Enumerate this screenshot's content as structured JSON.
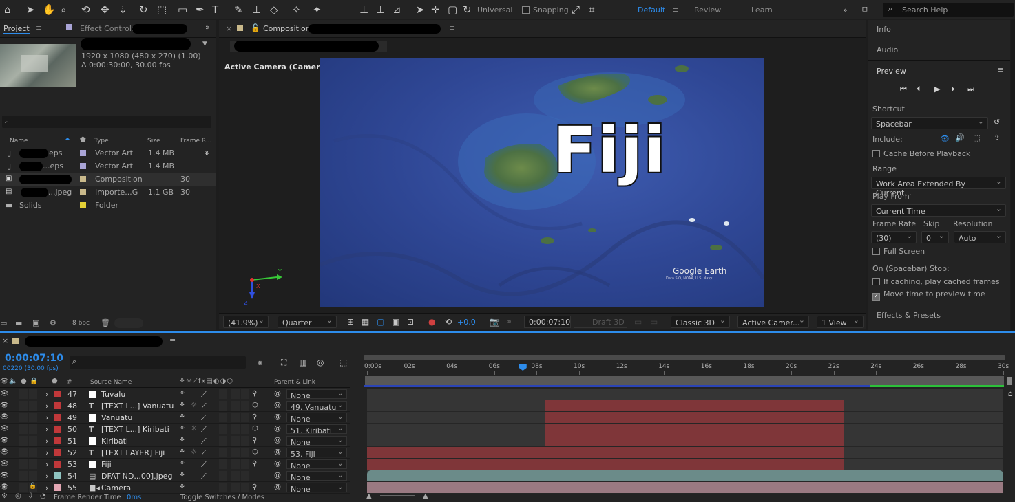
{
  "toolbar": {
    "mode_universal": "Universal",
    "snapping": "Snapping",
    "workspaces": [
      "Default",
      "Review",
      "Learn"
    ],
    "search_placeholder": "Search Help"
  },
  "project": {
    "tab": "Project",
    "effect_controls_tab": "Effect Controls",
    "comp_info_res": "1920 x 1080  (480 x 270) (1.00)",
    "comp_info_dur": "Δ 0:00:30:00, 30.00 fps",
    "search_icon": "search-icon",
    "columns": [
      "Name",
      "Type",
      "Size",
      "Frame R..."
    ],
    "items": [
      {
        "name": "eps",
        "type": "Vector Art",
        "size": "1.4 MB",
        "frame": "",
        "color": "#a9a4d6"
      },
      {
        "name": "...eps",
        "type": "Vector Art",
        "size": "1.4 MB",
        "frame": "",
        "color": "#a9a4d6"
      },
      {
        "name": "",
        "type": "Composition",
        "size": "",
        "frame": "30",
        "color": "#c9b98b"
      },
      {
        "name": "...jpeg",
        "type": "Importe...G",
        "size": "1.1 GB",
        "frame": "30",
        "color": "#c9b98b"
      },
      {
        "name": "Solids",
        "type": "Folder",
        "size": "",
        "frame": "",
        "color": "#e3cf36"
      }
    ],
    "bpc": "8 bpc"
  },
  "composition": {
    "tab": "Composition",
    "view_label": "Active Camera (Camera)",
    "map_text": "Fiji",
    "watermark": "Google Earth",
    "watermark_sub": "Data SIO, NOAA, U.S. Navy",
    "zoom": "(41.9%)",
    "resolution": "Quarter",
    "exposure": "+0.0",
    "timecode": "0:00:07:10",
    "draft": "Draft 3D",
    "renderer": "Classic 3D",
    "camera": "Active Camer...",
    "views": "1 View"
  },
  "right_panel": {
    "info": "Info",
    "audio": "Audio",
    "preview": "Preview",
    "shortcut_label": "Shortcut",
    "shortcut_value": "Spacebar",
    "include_label": "Include:",
    "cache_before": "Cache Before Playback",
    "range_label": "Range",
    "range_value": "Work Area Extended By Current...",
    "play_from_label": "Play From",
    "play_from_value": "Current Time",
    "frame_rate_label": "Frame Rate",
    "skip_label": "Skip",
    "resolution_label": "Resolution",
    "frame_rate_value": "(30)",
    "skip_value": "0",
    "resolution_value": "Auto",
    "full_screen": "Full Screen",
    "on_stop_label": "On (Spacebar) Stop:",
    "if_caching": "If caching, play cached frames",
    "move_time": "Move time to preview time",
    "effects_presets": "Effects & Presets"
  },
  "timeline": {
    "timecode": "0:00:07:10",
    "frame_info": "00220 (30.00 fps)",
    "col_source": "Source Name",
    "col_parent": "Parent & Link",
    "ruler": [
      "0:00s",
      "02s",
      "04s",
      "06s",
      "08s",
      "10s",
      "12s",
      "14s",
      "16s",
      "18s",
      "20s",
      "22s",
      "24s",
      "26s",
      "28s",
      "30s"
    ],
    "playhead_seconds": 7.33,
    "duration_seconds": 30,
    "layers": [
      {
        "num": "47",
        "type": "solid",
        "name": "Tuvalu",
        "parent": "None",
        "color": "#c0383a",
        "start": 0.0,
        "end": 22.5,
        "bar_color": "#353535",
        "bar_start": 0,
        "bar_end": 0
      },
      {
        "num": "48",
        "type": "text",
        "name": "[TEXT L...] Vanuatu",
        "parent": "49. Vanuatu",
        "color": "#c0383a",
        "bar_color": "#7f3639",
        "bar_start": 8.4,
        "bar_end": 22.5
      },
      {
        "num": "49",
        "type": "solid",
        "name": "Vanuatu",
        "parent": "None",
        "color": "#c0383a",
        "bar_color": "#7f3639",
        "bar_start": 8.4,
        "bar_end": 22.5
      },
      {
        "num": "50",
        "type": "text",
        "name": "[TEXT L...] Kiribati",
        "parent": "51. Kiribati",
        "color": "#c0383a",
        "bar_color": "#7f3639",
        "bar_start": 8.4,
        "bar_end": 22.5
      },
      {
        "num": "51",
        "type": "solid",
        "name": "Kiribati",
        "parent": "None",
        "color": "#c0383a",
        "bar_color": "#7f3639",
        "bar_start": 8.4,
        "bar_end": 22.5
      },
      {
        "num": "52",
        "type": "text",
        "name": "[TEXT LAYER] Fiji",
        "parent": "53. Fiji",
        "color": "#c0383a",
        "bar_color": "#7f3639",
        "bar_start": 0.0,
        "bar_end": 22.5
      },
      {
        "num": "53",
        "type": "solid",
        "name": "Fiji",
        "parent": "None",
        "color": "#c0383a",
        "bar_color": "#7f3639",
        "bar_start": 0.0,
        "bar_end": 22.5
      },
      {
        "num": "54",
        "type": "footage",
        "name": "DFAT ND...00].jpeg",
        "parent": "None",
        "color": "#8fc3c0",
        "bar_color": "#6b8b89",
        "bar_start": 0.0,
        "bar_end": 30.0
      },
      {
        "num": "55",
        "type": "camera",
        "name": "Camera",
        "parent": "None",
        "color": "#e3a6b3",
        "bar_color": "#9a7a82",
        "bar_start": 0.0,
        "bar_end": 30.0
      }
    ],
    "footer_render": "Frame Render Time",
    "footer_render_val": "0ms",
    "footer_toggle": "Toggle Switches / Modes"
  }
}
